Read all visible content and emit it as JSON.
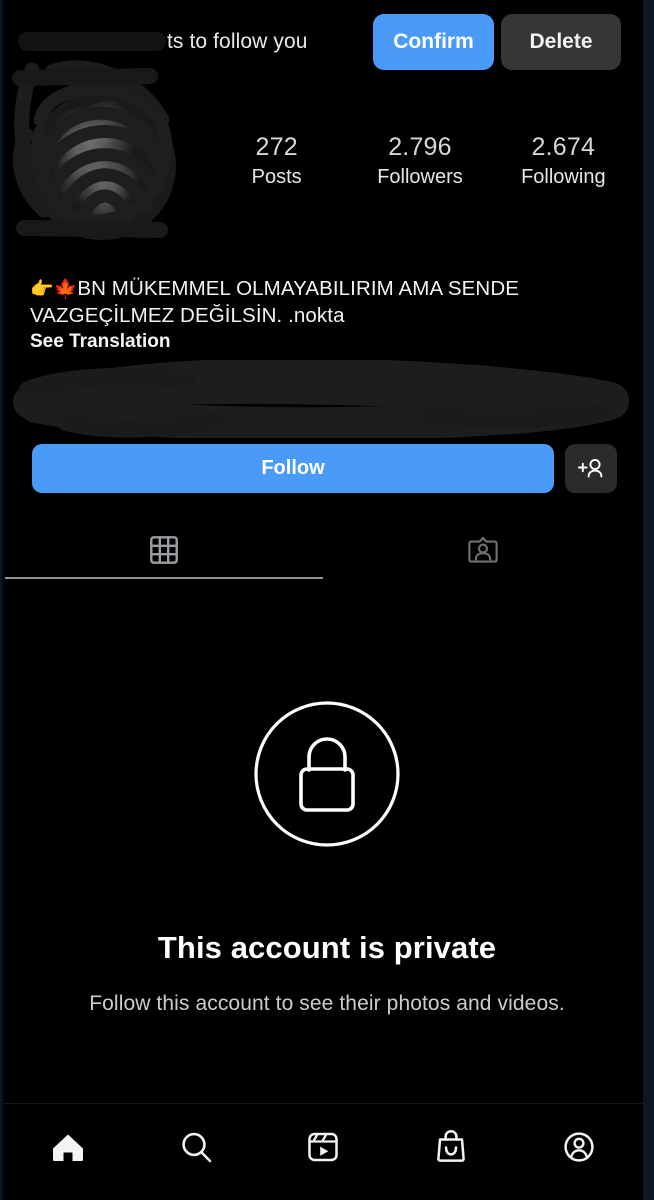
{
  "app": "instagram-profile",
  "colors": {
    "background": "#000000",
    "accent_blue": "#4a9bf7",
    "button_dark": "#363636",
    "text_primary": "#ffffff",
    "text_secondary": "#c9ccd0",
    "divider": "#8e9296"
  },
  "follow_request": {
    "text_visible": "ts to follow you",
    "username_redacted": true,
    "confirm_label": "Confirm",
    "delete_label": "Delete"
  },
  "profile": {
    "avatar_redacted": true,
    "stats": [
      {
        "value": "272",
        "label": "Posts"
      },
      {
        "value": "2.796",
        "label": "Followers"
      },
      {
        "value": "2.674",
        "label": "Following"
      }
    ],
    "bio_emoji": "👉🍁",
    "bio_line1": "BN MÜKEMMEL OLMAYABILIRIM AMA SENDE",
    "bio_line2": "VAZGEÇİLMEZ DEĞİLSİN. .nokta",
    "see_translation_label": "See Translation",
    "username_area_redacted": true
  },
  "actions": {
    "follow_label": "Follow",
    "add_user_icon": "add-person-icon"
  },
  "tabs": [
    {
      "icon": "grid-icon",
      "name": "posts-grid",
      "active": true
    },
    {
      "icon": "tagged-icon",
      "name": "tagged",
      "active": false
    }
  ],
  "private_notice": {
    "icon": "lock-icon",
    "title": "This account is private",
    "subtitle": "Follow this account to see their photos and videos."
  },
  "bottom_nav": [
    {
      "icon": "home-icon",
      "name": "home",
      "active": true
    },
    {
      "icon": "search-icon",
      "name": "search",
      "active": false
    },
    {
      "icon": "reels-icon",
      "name": "reels",
      "active": false
    },
    {
      "icon": "shop-icon",
      "name": "shop",
      "active": false
    },
    {
      "icon": "profile-icon",
      "name": "profile",
      "active": false
    }
  ]
}
